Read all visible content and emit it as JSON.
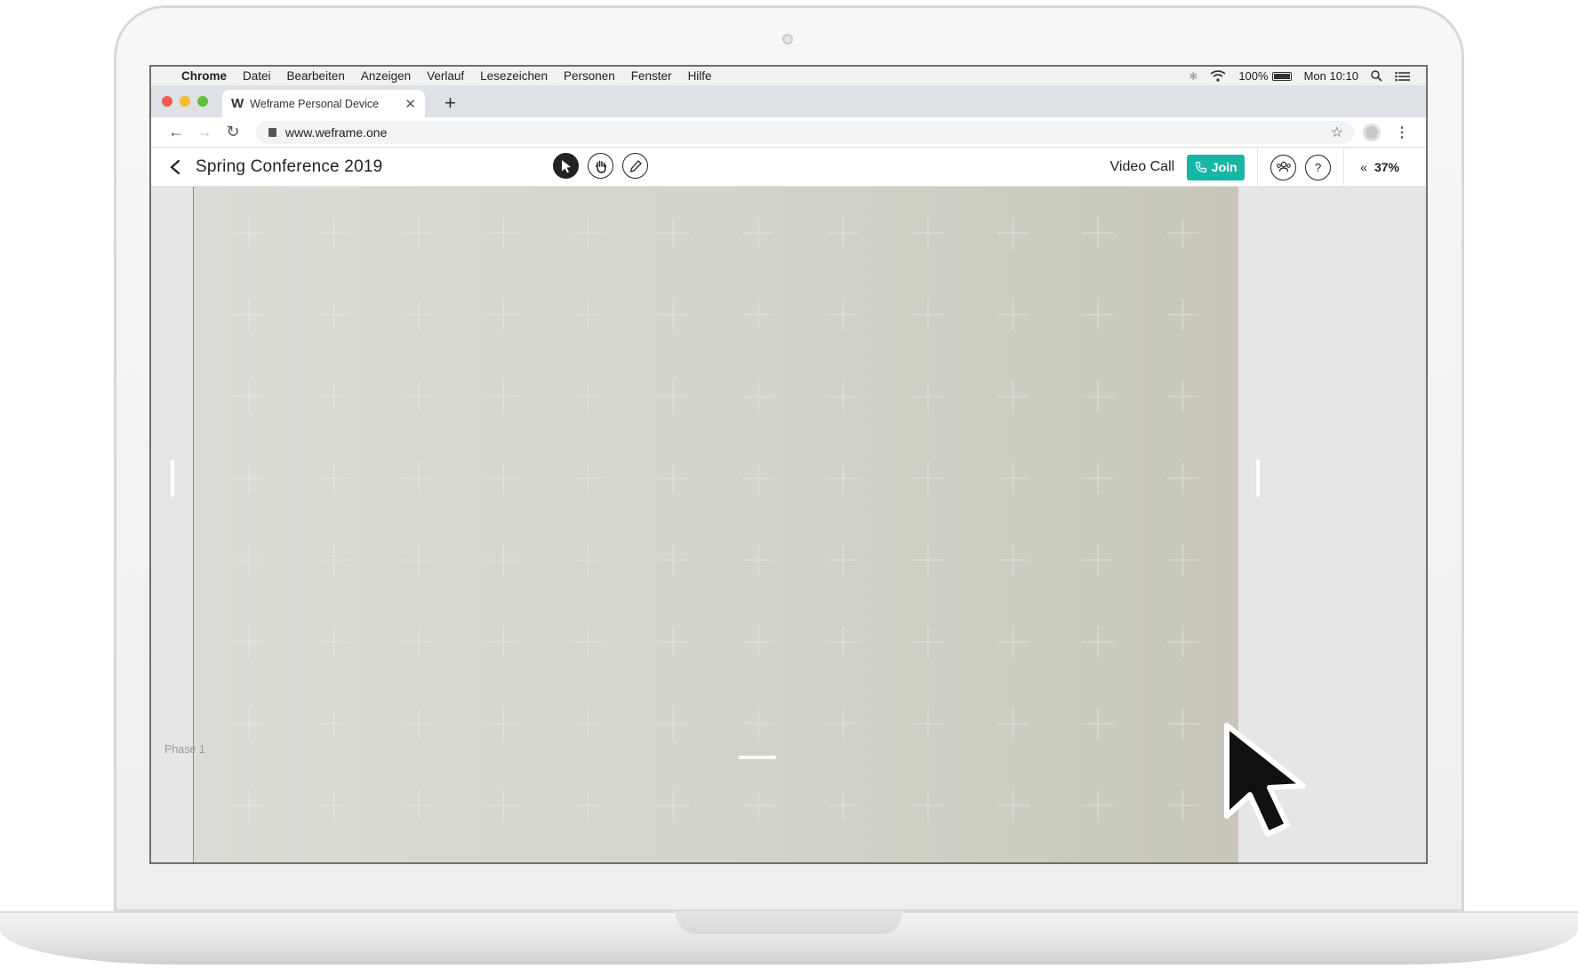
{
  "menubar": {
    "app": "Chrome",
    "items": [
      "Datei",
      "Bearbeiten",
      "Anzeigen",
      "Verlauf",
      "Lesezeichen",
      "Personen",
      "Fenster",
      "Hilfe"
    ],
    "battery": "100%",
    "clock": "Mon 10:10"
  },
  "browser": {
    "tab_title": "Weframe Personal Device",
    "tab_favicon": "W",
    "url": "www.weframe.one"
  },
  "app": {
    "board_title": "Spring Conference 2019",
    "video_call_label": "Video Call",
    "join_label": "Join",
    "zoom": "37%",
    "help_label": "?",
    "phase_label": "Phase 1"
  },
  "colors": {
    "join_button": "#18b6a4",
    "send_button": "#ef4850"
  },
  "icons": [
    "apple-icon",
    "bluetooth-icon",
    "wifi-icon",
    "battery-icon",
    "spotlight-search-icon",
    "notification-list-icon",
    "back-arrow-icon",
    "forward-arrow-icon",
    "reload-icon",
    "lock-icon",
    "star-icon",
    "profile-icon",
    "kebab-menu-icon",
    "chevron-left-icon",
    "pointer-tool-icon",
    "hand-tool-icon",
    "pen-tool-icon",
    "phone-icon",
    "participants-icon",
    "double-chevron-left-icon",
    "paper-plane-icon",
    "mouse-cursor-icon"
  ]
}
